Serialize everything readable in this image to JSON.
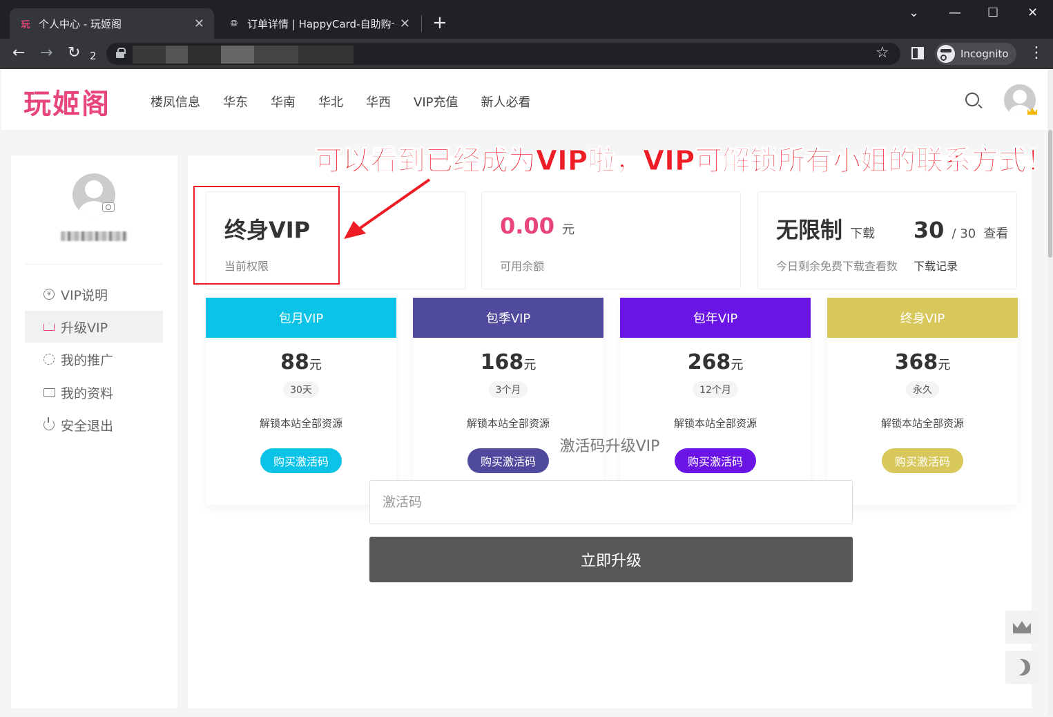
{
  "browser": {
    "tabs": [
      {
        "title": "个人中心 - 玩姬阁",
        "favicon": "玩",
        "active": true
      },
      {
        "title": "订单详情 | HappyCard-自助购卡",
        "active": false
      }
    ],
    "reload_count": "2",
    "profile_label": "Incognito"
  },
  "site": {
    "logo": "玩姬阁",
    "nav": [
      "楼凤信息",
      "华东",
      "华南",
      "华北",
      "华西",
      "VIP充值",
      "新人必看"
    ]
  },
  "annotation": "可以看到已经成为VIP啦，VIP可解锁所有小姐的联系方式！",
  "sidebar": {
    "items": [
      {
        "label": "VIP说明",
        "icon": "yen-circle-icon"
      },
      {
        "label": "升级VIP",
        "icon": "crown-icon",
        "active": true
      },
      {
        "label": "我的推广",
        "icon": "ring-icon"
      },
      {
        "label": "我的资料",
        "icon": "profile-card-icon"
      },
      {
        "label": "安全退出",
        "icon": "power-icon"
      }
    ]
  },
  "stats": {
    "permission": {
      "value": "终身VIP",
      "label": "当前权限"
    },
    "balance": {
      "value": "0.00",
      "unit": "元",
      "label": "可用余额"
    },
    "downloads": {
      "download_value": "无限制",
      "download_unit": "下载",
      "view_value": "30",
      "view_total": "/ 30",
      "view_unit": "查看",
      "label": "今日剩余免费下载查看数",
      "link": "下载记录"
    }
  },
  "plans": [
    {
      "name": "包月VIP",
      "price": "88",
      "unit": "元",
      "duration": "30天",
      "desc": "解锁本站全部资源",
      "button": "购买激活码",
      "color": "#0bc3e7"
    },
    {
      "name": "包季VIP",
      "price": "168",
      "unit": "元",
      "duration": "3个月",
      "desc": "解锁本站全部资源",
      "button": "购买激活码",
      "color": "#4f4a9e"
    },
    {
      "name": "包年VIP",
      "price": "268",
      "unit": "元",
      "duration": "12个月",
      "desc": "解锁本站全部资源",
      "button": "购买激活码",
      "color": "#6b14e6"
    },
    {
      "name": "终身VIP",
      "price": "368",
      "unit": "元",
      "duration": "永久",
      "desc": "解锁本站全部资源",
      "button": "购买激活码",
      "color": "#d8c75a"
    }
  ],
  "activation": {
    "title": "激活码升级VIP",
    "placeholder": "激活码",
    "button": "立即升级"
  },
  "colors": {
    "brand": "#e8457a",
    "annotation": "#ee1c25",
    "upgrade_button": "#575757"
  }
}
